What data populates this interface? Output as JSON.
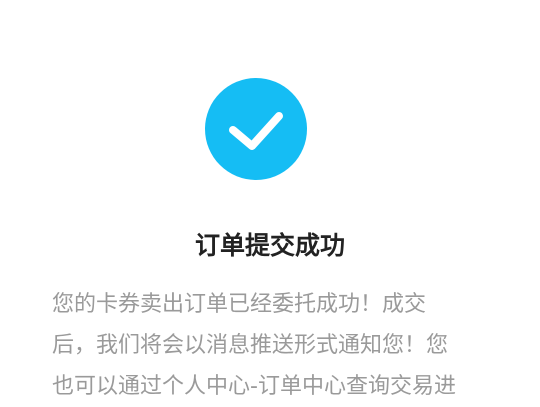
{
  "status": {
    "icon": "checkmark-icon",
    "icon_color": "#15bdf4",
    "check_color": "#ffffff"
  },
  "title": "订单提交成功",
  "message": {
    "lines": [
      "您的卡券卖出订单已经委托成功！成交",
      "后，我们将会以消息推送形式通知您！您",
      "也可以通过个人中心-订单中心查询交易进"
    ]
  },
  "colors": {
    "title_text": "#222222",
    "body_text": "#9a9a9a",
    "background": "#ffffff"
  }
}
